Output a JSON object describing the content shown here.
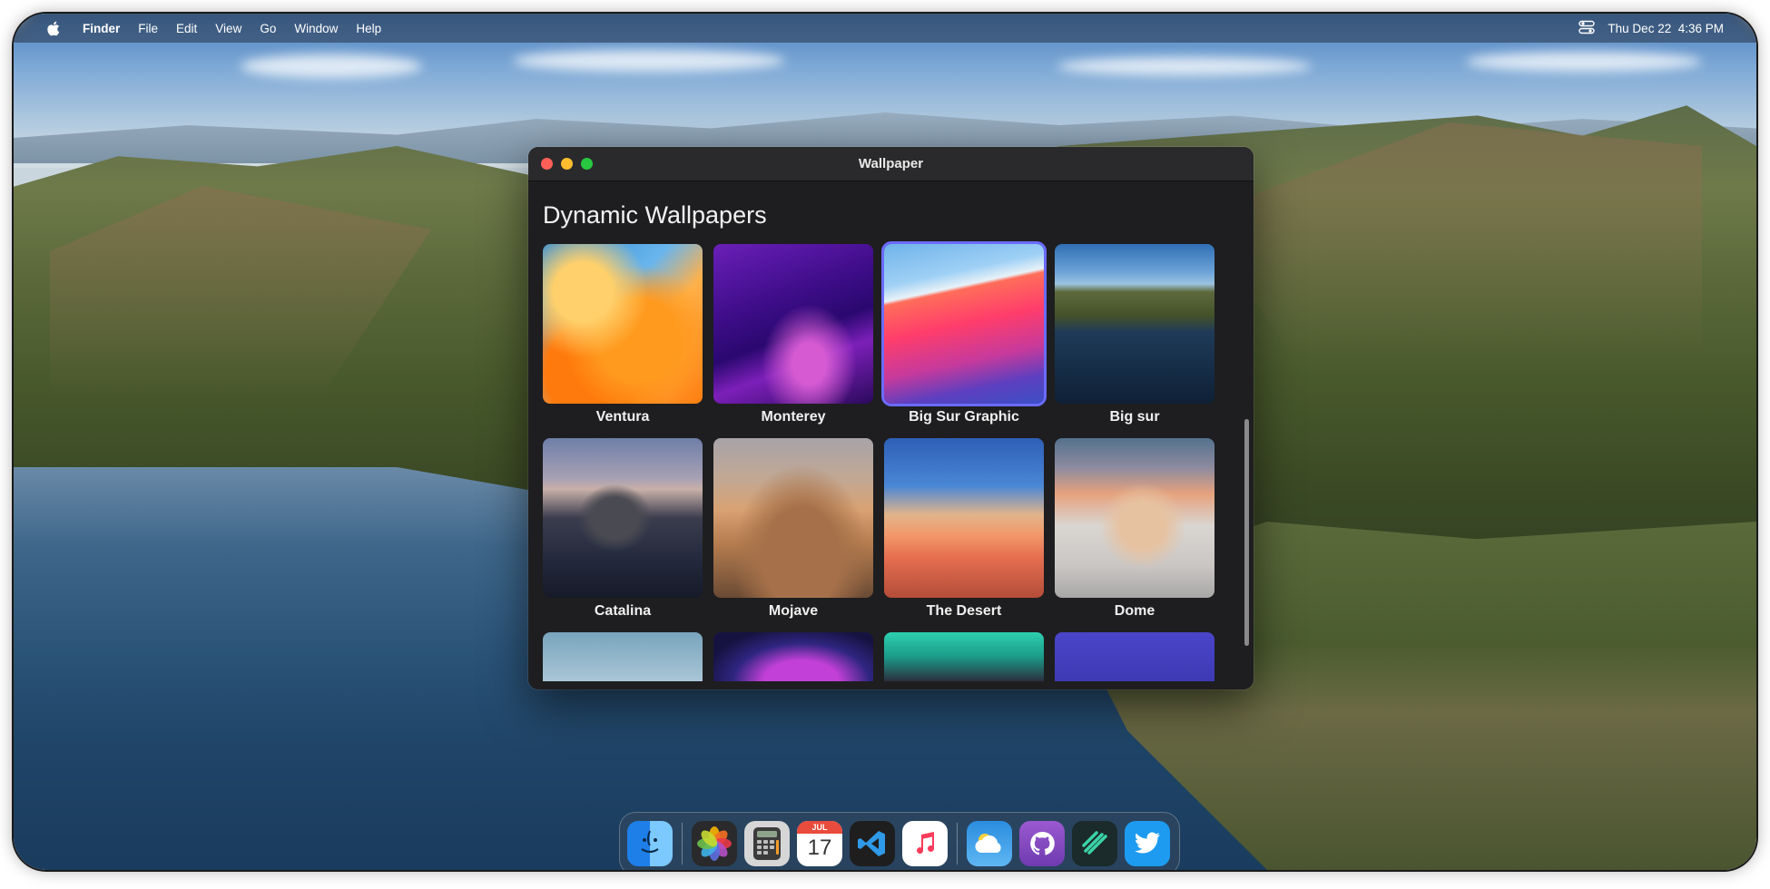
{
  "menubar": {
    "app_name": "Finder",
    "items": [
      "File",
      "Edit",
      "View",
      "Go",
      "Window",
      "Help"
    ],
    "datetime": "Thu Dec 22  4:36 PM"
  },
  "window": {
    "title": "Wallpaper",
    "section_title": "Dynamic Wallpapers",
    "wallpapers": [
      {
        "label": "Ventura",
        "selected": false
      },
      {
        "label": "Monterey",
        "selected": false
      },
      {
        "label": "Big Sur Graphic",
        "selected": true
      },
      {
        "label": "Big sur",
        "selected": false
      },
      {
        "label": "Catalina",
        "selected": false
      },
      {
        "label": "Mojave",
        "selected": false
      },
      {
        "label": "The Desert",
        "selected": false
      },
      {
        "label": "Dome",
        "selected": false
      }
    ]
  },
  "dock": {
    "apps": [
      {
        "icon": "finder-icon",
        "running": true
      },
      {
        "icon": "photos-icon",
        "running": true
      },
      {
        "icon": "calculator-icon",
        "running": false
      },
      {
        "icon": "calendar-icon",
        "running": false,
        "month": "JUL",
        "day": "17"
      },
      {
        "icon": "vscode-icon",
        "running": false
      },
      {
        "icon": "music-icon",
        "running": false
      },
      {
        "icon": "weather-icon",
        "running": false
      },
      {
        "icon": "github-icon",
        "running": true
      },
      {
        "icon": "notion-like-icon",
        "running": true
      },
      {
        "icon": "twitter-icon",
        "running": true
      }
    ]
  },
  "colors": {
    "accent_selection": "#6b6bff",
    "window_bg": "#1e1e20"
  }
}
